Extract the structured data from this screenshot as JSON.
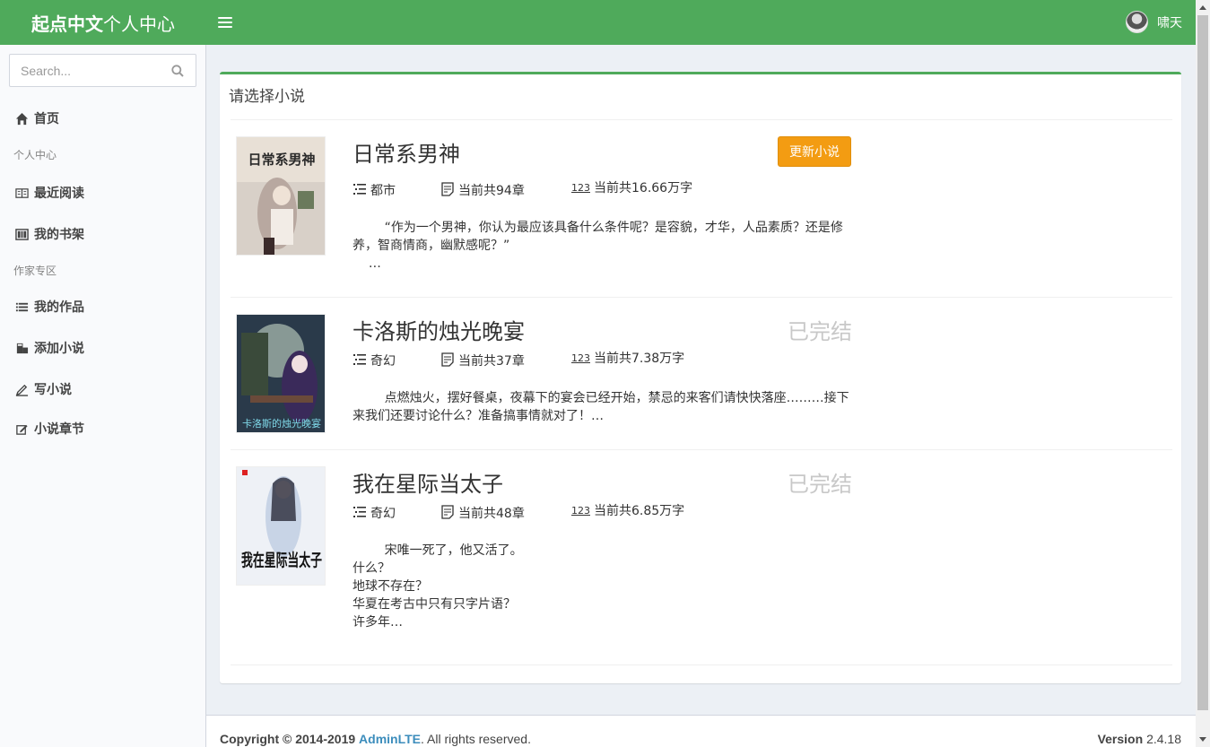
{
  "header": {
    "brand_bold": "起点中文",
    "brand_light": "个人中心",
    "user_name": "啸天"
  },
  "sidebar": {
    "search_placeholder": "Search...",
    "home": "首页",
    "section_personal": "个人中心",
    "recent_reading": "最近阅读",
    "bookshelf": "我的书架",
    "section_author": "作家专区",
    "my_works": "我的作品",
    "add_novel": "添加小说",
    "write_novel": "写小说",
    "chapters": "小说章节"
  },
  "main": {
    "box_title": "请选择小说",
    "books": [
      {
        "title": "日常系男神",
        "genre": "都市",
        "chapters": "当前共94章",
        "words": "当前共16.66万字",
        "action": "更新小说",
        "description": "        “作为一个男神，你认为最应该具备什么条件呢？是容貌，才华，人品素质？还是修养，智商情商，幽默感呢？”\n    …",
        "cover_text": "日常系男神"
      },
      {
        "title": "卡洛斯的烛光晚宴",
        "genre": "奇幻",
        "chapters": "当前共37章",
        "words": "当前共7.38万字",
        "status": "已完结",
        "description": "        点燃烛火，摆好餐桌，夜幕下的宴会已经开始，禁忌的来客们请快快落座………接下来我们还要讨论什么？准备搞事情就对了！…",
        "cover_text": "卡洛斯的烛光晚宴"
      },
      {
        "title": "我在星际当太子",
        "genre": "奇幻",
        "chapters": "当前共48章",
        "words": "当前共6.85万字",
        "status": "已完结",
        "description": "        宋唯一死了，他又活了。\n什么？\n地球不存在？\n华夏在考古中只有只字片语？\n许多年…",
        "cover_text": "我在星际当太子"
      }
    ]
  },
  "footer": {
    "copyright": "Copyright © 2014-2019",
    "brand_link": "AdminLTE",
    "rights": ". All rights reserved.",
    "version_label": "Version",
    "version": "2.4.18"
  },
  "colors": {
    "brand": "#4faa5b",
    "warning": "#f39c12",
    "link": "#3c8dbc"
  },
  "icons": [
    "hamburger-icon",
    "user-avatar",
    "search-icon",
    "home-icon",
    "book-open-icon",
    "bookshelf-icon",
    "list-icon",
    "add-book-icon",
    "pen-icon",
    "edit-icon",
    "genre-list-icon",
    "chapters-doc-icon",
    "word-count-icon"
  ]
}
